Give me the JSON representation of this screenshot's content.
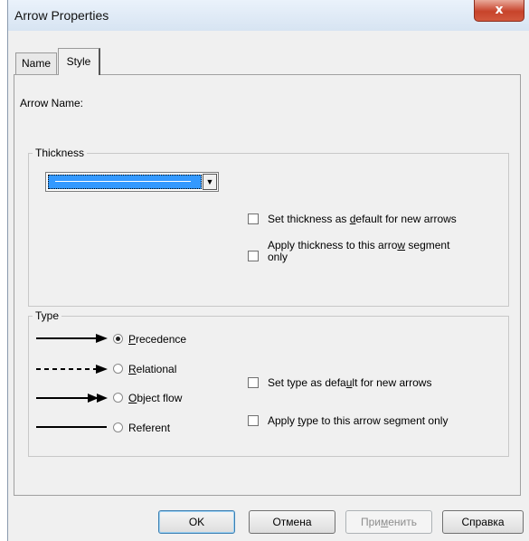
{
  "window": {
    "title": "Arrow Properties",
    "close_glyph": "x"
  },
  "tabs": [
    {
      "label": "Name"
    },
    {
      "label": "Style"
    }
  ],
  "arrow_name_label": "Arrow Name:",
  "thickness": {
    "legend": "Thickness",
    "selected_value": "thin line",
    "checkboxes": [
      {
        "label_pre": "Set thickness as ",
        "label_ul": "d",
        "label_post": "efault for new arrows",
        "checked": false
      },
      {
        "label_pre": "Apply thickness to this arro",
        "label_ul": "w",
        "label_post": " segment",
        "label_line2": "only",
        "checked": false
      }
    ]
  },
  "type": {
    "legend": "Type",
    "options": [
      {
        "label_ul": "P",
        "label_post": "recedence",
        "selected": true,
        "arrow_style": "solid-arrow"
      },
      {
        "label_ul": "R",
        "label_post": "elational",
        "selected": false,
        "arrow_style": "dashed-arrow"
      },
      {
        "label_ul": "O",
        "label_post": "bject flow",
        "selected": false,
        "arrow_style": "double-arrow"
      },
      {
        "label_ul": "",
        "label_post": "Referent",
        "selected": false,
        "arrow_style": "plain-line"
      }
    ],
    "checkboxes": [
      {
        "label_pre": "Set type as defa",
        "label_ul": "u",
        "label_post": "lt for new arrows",
        "checked": false
      },
      {
        "label_pre": "Apply ",
        "label_ul": "t",
        "label_post": "ype to this arrow segment only",
        "checked": false
      }
    ]
  },
  "buttons": {
    "ok": "OK",
    "cancel": "Отмена",
    "apply_pre": "При",
    "apply_ul": "м",
    "apply_post": "енить",
    "help": "Справка"
  },
  "colors": {
    "selection": "#3399ff",
    "close": "#c7432b"
  }
}
